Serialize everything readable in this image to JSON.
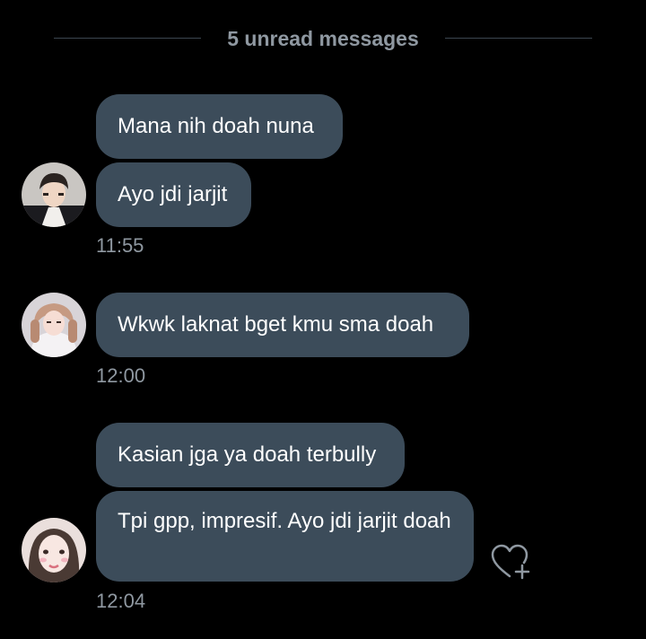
{
  "divider": {
    "label": "5 unread messages"
  },
  "groups": [
    {
      "messages": [
        "Mana nih doah nuna",
        "Ayo jdi jarjit"
      ],
      "time": "11:55"
    },
    {
      "messages": [
        "Wkwk laknat bget kmu sma doah"
      ],
      "time": "12:00"
    },
    {
      "messages": [
        "Kasian jga ya doah terbully",
        "Tpi gpp, impresif. Ayo jdi jarjit doah"
      ],
      "time": "12:04"
    }
  ],
  "icons": {
    "reaction": "heart-add-icon"
  },
  "colors": {
    "background": "#000000",
    "bubble": "#3c4c5a",
    "muted_text": "#8f98a1",
    "divider_line": "#3c4650"
  }
}
